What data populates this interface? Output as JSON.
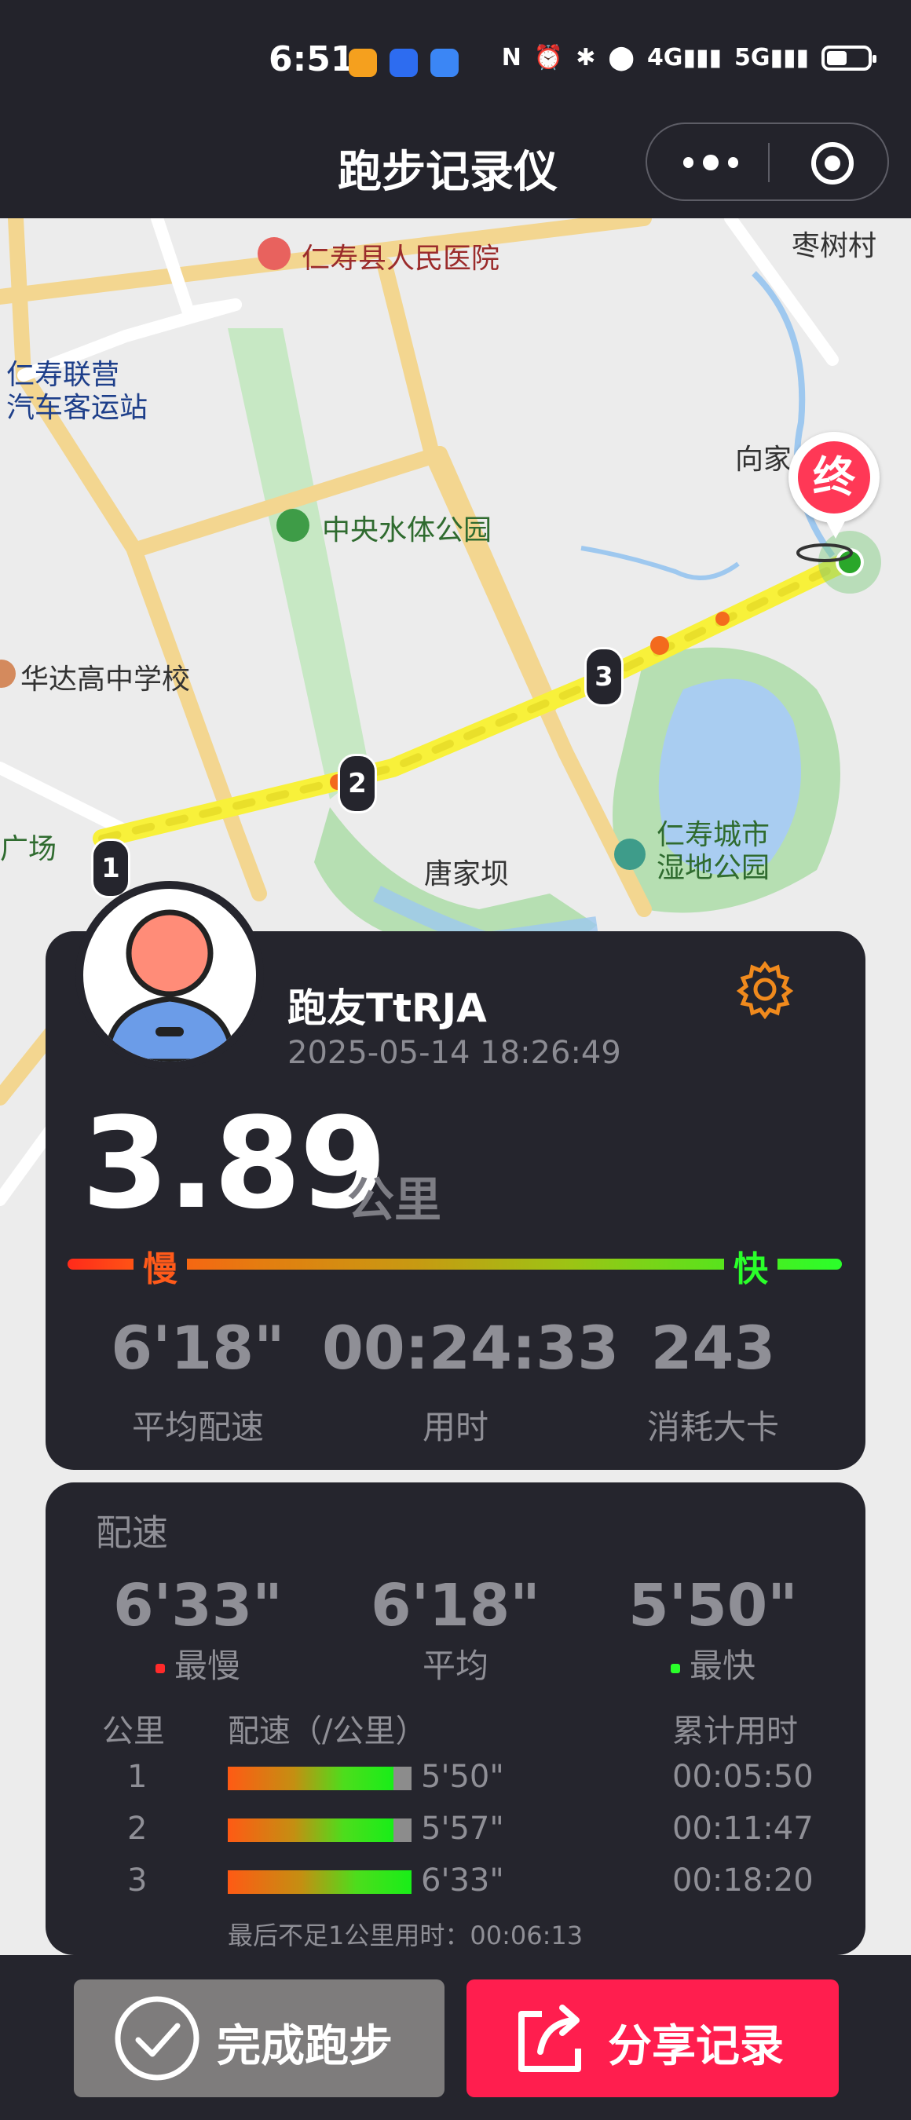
{
  "status_bar": {
    "time": "6:51",
    "network_labels": [
      "4G",
      "5G"
    ],
    "battery_level": 0.55
  },
  "title_bar": {
    "title": "跑步记录仪",
    "more_icon": "more-dots-icon",
    "target_icon": "target-icon"
  },
  "map": {
    "labels": {
      "hospital": "仁寿县人民医院",
      "village": "枣树村",
      "bus_station_line1": "仁寿联营",
      "bus_station_line2": "汽车客运站",
      "xiangjia": "向家",
      "park": "中央水体公园",
      "school": "华达高中学校",
      "plaza": "广场",
      "tangjiaba": "唐家坝",
      "wetland_line1": "仁寿城市",
      "wetland_line2": "湿地公园"
    },
    "end_marker": "终",
    "km_markers": [
      "1",
      "2",
      "3"
    ]
  },
  "summary": {
    "username": "跑友TtRJA",
    "datetime": "2025-05-14 18:26:49",
    "distance": "3.89",
    "distance_unit": "公里",
    "slow_label": "慢",
    "fast_label": "快",
    "avg_pace": "6'18\"",
    "avg_pace_label": "平均配速",
    "duration": "00:24:33",
    "duration_label": "用时",
    "calories": "243",
    "calories_label": "消耗大卡",
    "colors": {
      "slow": "#ff2a1a",
      "fast": "#2aff2a",
      "gear": "#f08a1d"
    }
  },
  "pace": {
    "title": "配速",
    "slowest": "6'33\"",
    "slowest_label": "最慢",
    "average": "6'18\"",
    "average_label": "平均",
    "fastest": "5'50\"",
    "fastest_label": "最快",
    "headers": {
      "km": "公里",
      "pace": "配速（/公里）",
      "cumulative": "累计用时"
    },
    "splits": [
      {
        "km": "1",
        "pace": "5'50\"",
        "cumulative": "00:05:50",
        "fill": 0.9
      },
      {
        "km": "2",
        "pace": "5'57\"",
        "cumulative": "00:11:47",
        "fill": 0.9
      },
      {
        "km": "3",
        "pace": "6'33\"",
        "cumulative": "00:18:20",
        "fill": 1.0
      }
    ],
    "footnote": "最后不足1公里用时：00:06:13"
  },
  "actions": {
    "finish_label": "完成跑步",
    "share_label": "分享记录",
    "colors": {
      "finish": "#7e7c7c",
      "share": "#ff1e4e"
    }
  }
}
